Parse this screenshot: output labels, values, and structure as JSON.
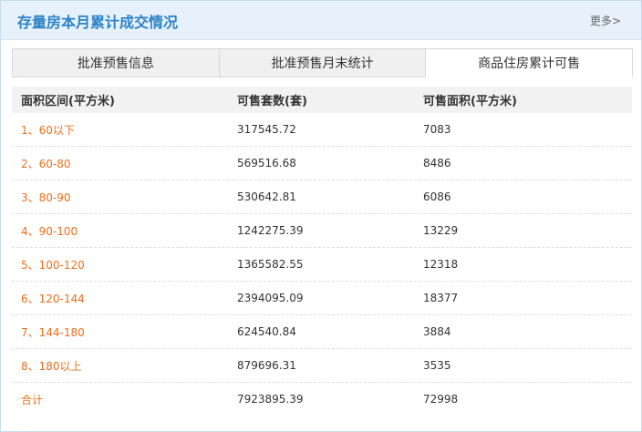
{
  "panel": {
    "title": "存量房本月累计成交情况",
    "more_label": "更多>"
  },
  "tabs": [
    {
      "label": "批准预售信息",
      "active": false
    },
    {
      "label": "批准预售月末统计",
      "active": false
    },
    {
      "label": "商品住房累计可售",
      "active": true
    }
  ],
  "table": {
    "columns": [
      "面积区间(平方米)",
      "可售套数(套)",
      "可售面积(平方米)"
    ],
    "rows": [
      [
        "1、60以下",
        "317545.72",
        "7083"
      ],
      [
        "2、60-80",
        "569516.68",
        "8486"
      ],
      [
        "3、80-90",
        "530642.81",
        "6086"
      ],
      [
        "4、90-100",
        "1242275.39",
        "13229"
      ],
      [
        "5、100-120",
        "1365582.55",
        "12318"
      ],
      [
        "6、120-144",
        "2394095.09",
        "18377"
      ],
      [
        "7、144-180",
        "624540.84",
        "3884"
      ],
      [
        "8、180以上",
        "879696.31",
        "3535"
      ],
      [
        "合计",
        "7923895.39",
        "72998"
      ]
    ]
  },
  "colors": {
    "title": "#2d83c7",
    "header_bg": "#e6f1fb",
    "range_text": "#e8701e"
  }
}
